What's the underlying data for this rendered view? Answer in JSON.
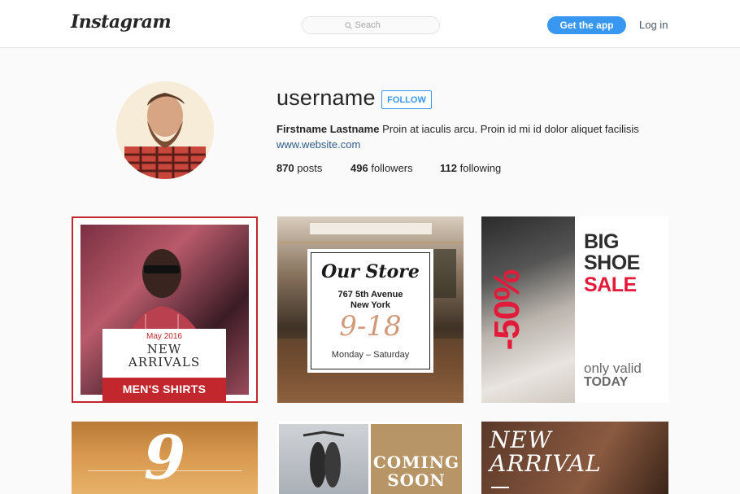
{
  "header": {
    "logo_text": "Instagram",
    "search_placeholder": "Seach",
    "get_app_label": "Get the app",
    "login_label": "Log in"
  },
  "profile": {
    "username": "username",
    "follow_label": "FOLLOW",
    "full_name": "Firstname Lastname",
    "bio": "Proin at iaculis arcu. Proin id mi id dolor aliquet facilisis",
    "website": "www.website.com",
    "stats": {
      "posts_count": "870",
      "posts_label": "posts",
      "followers_count": "496",
      "followers_label": "followers",
      "following_count": "112",
      "following_label": "following"
    }
  },
  "posts": [
    {
      "date": "May 2016",
      "title_line1": "NEW",
      "title_line2": "ARRIVALS",
      "band": "MEN'S SHIRTS"
    },
    {
      "title": "Our Store",
      "address_line1": "767 5th Avenue",
      "address_line2": "New York",
      "hours": "9-18",
      "days": "Monday – Saturday"
    },
    {
      "discount": "-50%",
      "line1": "BIG",
      "line2": "SHOE",
      "line3": "SALE",
      "valid_line1": "only valid",
      "valid_line2": "TODAY"
    },
    {
      "number": "9"
    },
    {
      "line1": "COMING",
      "line2": "SOON"
    },
    {
      "line1": "NEW",
      "line2": "ARRIVAL"
    }
  ],
  "colors": {
    "accent_blue": "#3897f0",
    "sale_red": "#e31b3a",
    "shirt_red": "#c1272d"
  }
}
